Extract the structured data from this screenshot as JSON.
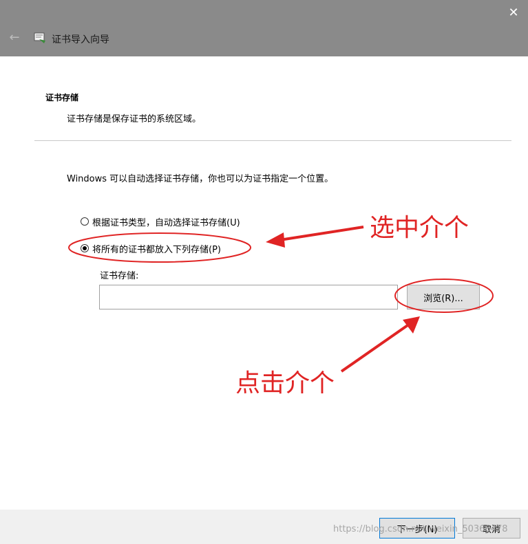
{
  "window": {
    "title": "证书导入向导",
    "back_icon": "back-arrow-icon",
    "close_glyph": "✕"
  },
  "page": {
    "heading": "证书存储",
    "description": "证书存储是保存证书的系统区域。",
    "intro": "Windows 可以自动选择证书存储，你也可以为证书指定一个位置。"
  },
  "options": {
    "auto_label": "根据证书类型，自动选择证书存储(U)",
    "manual_label": "将所有的证书都放入下列存储(P)",
    "selected": "manual"
  },
  "store": {
    "label": "证书存储:",
    "value": "",
    "browse_label": "浏览(R)..."
  },
  "footer": {
    "next_label": "下一步(N)",
    "cancel_label": "取消"
  },
  "annotations": {
    "select_text": "选中介个",
    "click_text": "点击介个",
    "color": "#e02424"
  },
  "watermark": "https://blog.csdn.net/weixin_50366478"
}
